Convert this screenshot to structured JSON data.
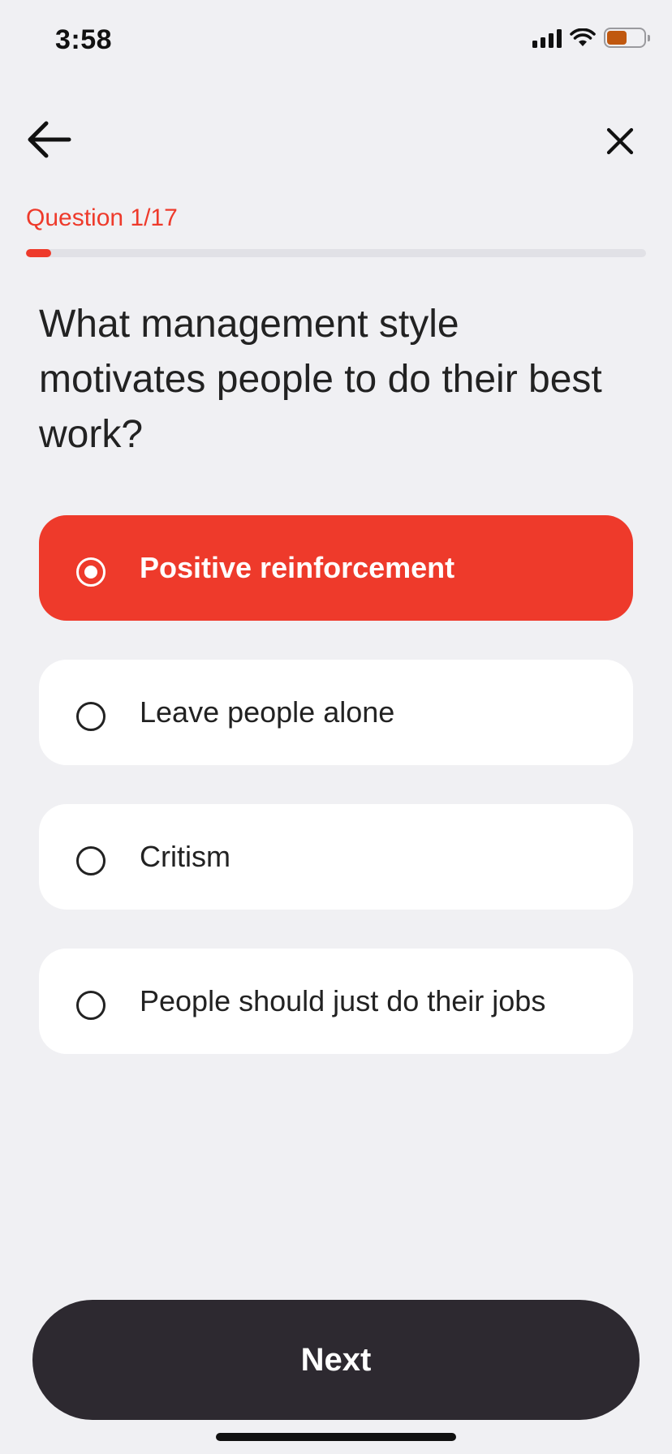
{
  "status_bar": {
    "time": "3:58",
    "icons": [
      "signal-icon",
      "wifi-icon",
      "battery-icon"
    ],
    "battery_color": "#c0580f",
    "battery_level": 0.55
  },
  "nav": {
    "back_icon": "arrow-left-icon",
    "close_icon": "close-icon"
  },
  "quiz": {
    "counter_label": "Question 1/17",
    "progress": 0.04,
    "question": "What management style motivates people to do their best work?",
    "options": [
      {
        "label": "Positive reinforcement",
        "selected": true
      },
      {
        "label": "Leave people alone",
        "selected": false
      },
      {
        "label": "Critism",
        "selected": false
      },
      {
        "label": "People should just do their jobs",
        "selected": false
      }
    ]
  },
  "footer": {
    "next_label": "Next"
  },
  "colors": {
    "accent": "#ee3a2b",
    "background": "#f0f0f3",
    "button_dark": "#2d2930"
  }
}
